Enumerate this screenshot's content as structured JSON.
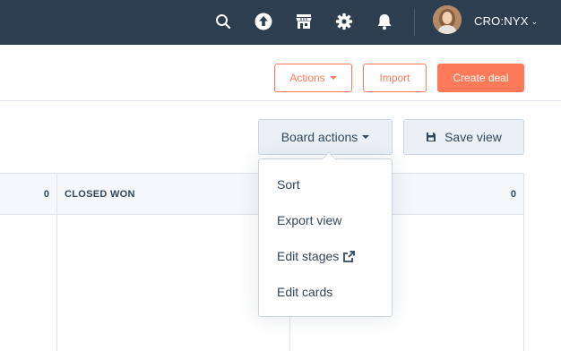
{
  "topnav": {
    "icons": [
      "search-icon",
      "upload-icon",
      "marketplace-icon",
      "gear-icon",
      "bell-icon"
    ],
    "account_name": "CRO:NYX"
  },
  "header": {
    "actions_label": "Actions",
    "import_label": "Import",
    "create_label": "Create deal"
  },
  "toolbar": {
    "board_actions_label": "Board actions",
    "save_view_label": "Save view"
  },
  "board": {
    "columns": [
      {
        "title": "",
        "count": "0"
      },
      {
        "title": "CLOSED WON",
        "count": ""
      },
      {
        "title": "",
        "count": "0"
      }
    ]
  },
  "menu": {
    "items": [
      "Sort",
      "Export view",
      "Edit stages",
      "Edit cards"
    ]
  },
  "colors": {
    "nav_bg": "#2d3e50",
    "accent": "#ff7a59",
    "text": "#33475b"
  }
}
